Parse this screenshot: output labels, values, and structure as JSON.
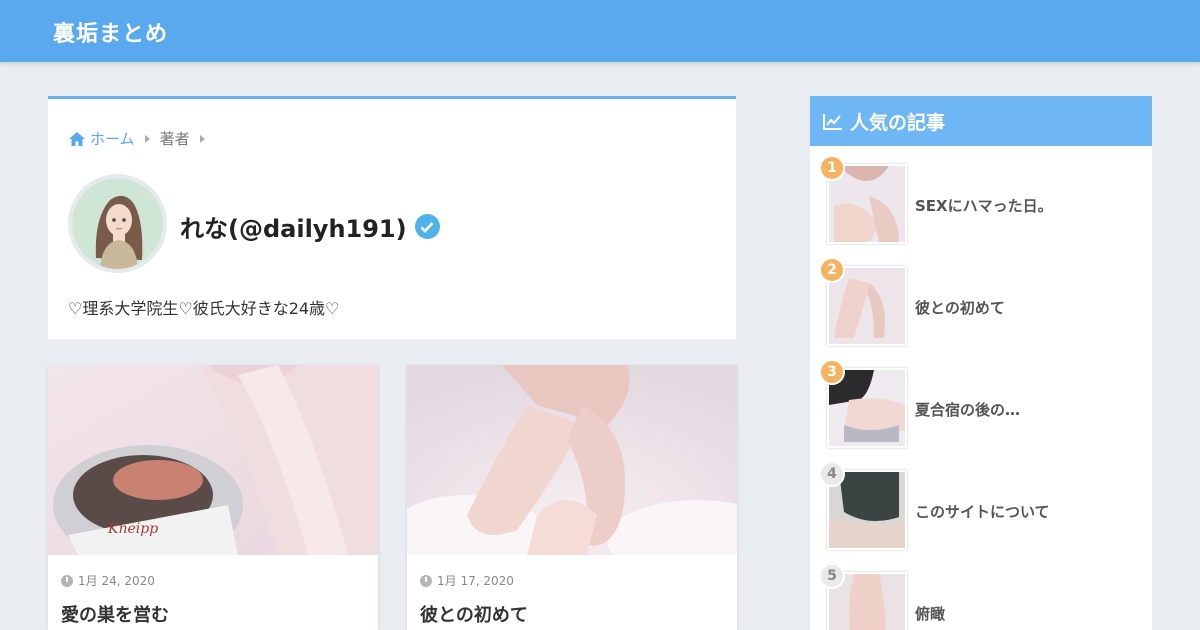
{
  "header": {
    "site_title": "裏垢まとめ",
    "bg_color": "#5aa9ee"
  },
  "breadcrumb": {
    "home_label": "ホーム",
    "current_label": "著者"
  },
  "author": {
    "name": "れな(@dailyh191)",
    "bio": "♡理系大学院生♡彼氏大好きな24歳♡",
    "verified_icon": "verified-check-icon"
  },
  "posts": [
    {
      "date": "1月 24, 2020",
      "title": "愛の巣を営む"
    },
    {
      "date": "1月 17, 2020",
      "title": "彼との初めて"
    }
  ],
  "sidebar": {
    "title": "人気の記事",
    "title_icon": "trend-chart-icon",
    "items": [
      {
        "rank": "1",
        "title": "SEXにハマった日。"
      },
      {
        "rank": "2",
        "title": "彼との初めて"
      },
      {
        "rank": "3",
        "title": "夏合宿の後の…"
      },
      {
        "rank": "4",
        "title": "このサイトについて"
      },
      {
        "rank": "5",
        "title": "俯瞰"
      }
    ]
  },
  "colors": {
    "accent": "#5aa9ee",
    "sidebar_head": "#6fb6f5",
    "rank_top": "#f6b35f",
    "verified": "#4fb3ea"
  }
}
